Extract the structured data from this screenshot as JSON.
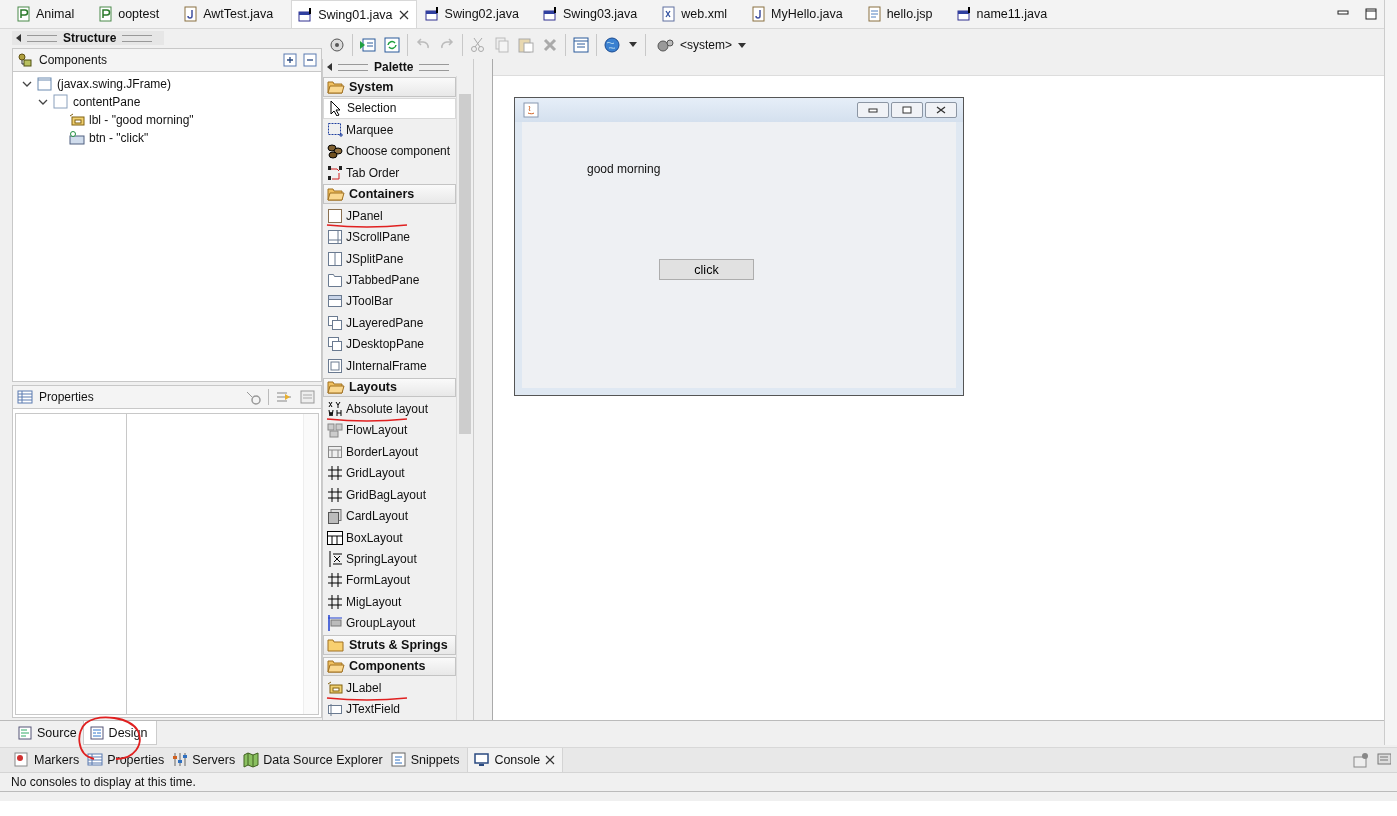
{
  "editor_tabs": [
    {
      "label": "Animal",
      "kind": "project",
      "selected": false
    },
    {
      "label": "ooptest",
      "kind": "project",
      "selected": false
    },
    {
      "label": "AwtTest.java",
      "kind": "java",
      "selected": false
    },
    {
      "label": "Swing01.java",
      "kind": "swing",
      "selected": true
    },
    {
      "label": "Swing02.java",
      "kind": "swing",
      "selected": false
    },
    {
      "label": "Swing03.java",
      "kind": "swing",
      "selected": false
    },
    {
      "label": "web.xml",
      "kind": "xml",
      "selected": false
    },
    {
      "label": "MyHello.java",
      "kind": "java",
      "selected": false
    },
    {
      "label": "hello.jsp",
      "kind": "jsp",
      "selected": false
    },
    {
      "label": "name11.java",
      "kind": "swing",
      "selected": false
    }
  ],
  "structure": {
    "title": "Structure",
    "components": {
      "title": "Components",
      "tree": [
        {
          "label": "(javax.swing.JFrame)",
          "kind": "frame",
          "expanded": true,
          "children": [
            {
              "label": "contentPane",
              "kind": "panel",
              "expanded": true,
              "children": [
                {
                  "label": "lbl - \"good morning\"",
                  "kind": "label"
                },
                {
                  "label": "btn - \"click\"",
                  "kind": "button"
                }
              ]
            }
          ]
        }
      ]
    },
    "properties": {
      "title": "Properties"
    }
  },
  "toolbar": {
    "system": "<system>"
  },
  "palette": {
    "title": "Palette",
    "items": [
      {
        "kind": "category",
        "label": "System",
        "expanded": true
      },
      {
        "kind": "tool",
        "label": "Selection",
        "selected": true,
        "underlined": false
      },
      {
        "kind": "tool",
        "label": "Marquee",
        "selected": false,
        "underlined": false
      },
      {
        "kind": "tool",
        "label": "Choose component",
        "selected": false,
        "underlined": false
      },
      {
        "kind": "tool",
        "label": "Tab Order",
        "selected": false,
        "underlined": false
      },
      {
        "kind": "category",
        "label": "Containers",
        "expanded": true
      },
      {
        "kind": "tool",
        "label": "JPanel",
        "selected": false,
        "underlined": true
      },
      {
        "kind": "tool",
        "label": "JScrollPane",
        "selected": false,
        "underlined": false
      },
      {
        "kind": "tool",
        "label": "JSplitPane",
        "selected": false,
        "underlined": false
      },
      {
        "kind": "tool",
        "label": "JTabbedPane",
        "selected": false,
        "underlined": false
      },
      {
        "kind": "tool",
        "label": "JToolBar",
        "selected": false,
        "underlined": false
      },
      {
        "kind": "tool",
        "label": "JLayeredPane",
        "selected": false,
        "underlined": false
      },
      {
        "kind": "tool",
        "label": "JDesktopPane",
        "selected": false,
        "underlined": false
      },
      {
        "kind": "tool",
        "label": "JInternalFrame",
        "selected": false,
        "underlined": false
      },
      {
        "kind": "category",
        "label": "Layouts",
        "expanded": true
      },
      {
        "kind": "tool",
        "label": "Absolute layout",
        "selected": false,
        "underlined": true
      },
      {
        "kind": "tool",
        "label": "FlowLayout",
        "selected": false,
        "underlined": false
      },
      {
        "kind": "tool",
        "label": "BorderLayout",
        "selected": false,
        "underlined": false
      },
      {
        "kind": "tool",
        "label": "GridLayout",
        "selected": false,
        "underlined": false
      },
      {
        "kind": "tool",
        "label": "GridBagLayout",
        "selected": false,
        "underlined": false
      },
      {
        "kind": "tool",
        "label": "CardLayout",
        "selected": false,
        "underlined": false
      },
      {
        "kind": "tool",
        "label": "BoxLayout",
        "selected": false,
        "underlined": false
      },
      {
        "kind": "tool",
        "label": "SpringLayout",
        "selected": false,
        "underlined": false
      },
      {
        "kind": "tool",
        "label": "FormLayout",
        "selected": false,
        "underlined": false
      },
      {
        "kind": "tool",
        "label": "MigLayout",
        "selected": false,
        "underlined": false
      },
      {
        "kind": "tool",
        "label": "GroupLayout",
        "selected": false,
        "underlined": false
      },
      {
        "kind": "category",
        "label": "Struts & Springs",
        "expanded": false
      },
      {
        "kind": "category",
        "label": "Components",
        "expanded": true
      },
      {
        "kind": "tool",
        "label": "JLabel",
        "selected": false,
        "underlined": true
      },
      {
        "kind": "tool",
        "label": "JTextField",
        "selected": false,
        "underlined": false
      }
    ]
  },
  "design_frame": {
    "label": "good morning",
    "button": "click"
  },
  "editor_mode_tabs": [
    {
      "label": "Source",
      "selected": false,
      "circled": false
    },
    {
      "label": "Design",
      "selected": true,
      "circled": true
    }
  ],
  "bottom_panel": {
    "tabs": [
      {
        "label": "Markers",
        "selected": false
      },
      {
        "label": "Properties",
        "selected": false
      },
      {
        "label": "Servers",
        "selected": false
      },
      {
        "label": "Data Source Explorer",
        "selected": false
      },
      {
        "label": "Snippets",
        "selected": false
      },
      {
        "label": "Console",
        "selected": true
      }
    ],
    "message": "No consoles to display at this time."
  }
}
